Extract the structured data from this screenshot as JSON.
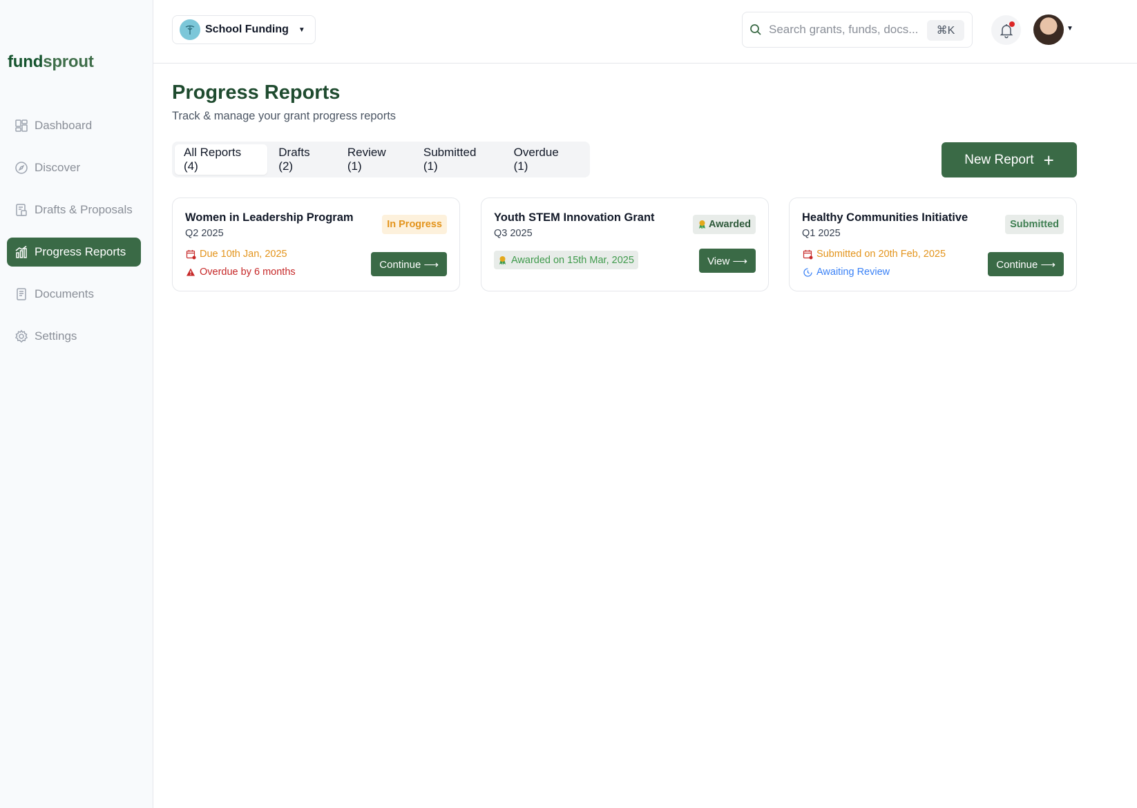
{
  "brand": {
    "part1": "fund",
    "part2": "sprout"
  },
  "sidebar": {
    "items": [
      {
        "label": "Dashboard",
        "icon": "dashboard-icon"
      },
      {
        "label": "Discover",
        "icon": "compass-icon"
      },
      {
        "label": "Drafts & Proposals",
        "icon": "drafts-icon"
      },
      {
        "label": "Progress Reports",
        "icon": "chart-icon",
        "active": true
      },
      {
        "label": "Documents",
        "icon": "documents-icon"
      },
      {
        "label": "Settings",
        "icon": "gear-icon"
      }
    ]
  },
  "header": {
    "org_name": "School Funding",
    "search_placeholder": "Search grants, funds, docs...",
    "search_shortcut": "⌘K"
  },
  "main": {
    "title": "Progress Reports",
    "subtitle": "Track & manage your grant progress reports",
    "tabs": [
      {
        "label": "All Reports (4)",
        "active": true
      },
      {
        "label": "Drafts (2)"
      },
      {
        "label": "Review (1)"
      },
      {
        "label": "Submitted (1)"
      },
      {
        "label": "Overdue (1)"
      }
    ],
    "new_report_label": "New Report",
    "cards": [
      {
        "title": "Women in Leadership Program",
        "quarter": "Q2 2025",
        "badge": "In Progress",
        "line1": "Due 10th Jan, 2025",
        "line2": "Overdue by 6 months",
        "button": "Continue ⟶"
      },
      {
        "title": "Youth STEM Innovation Grant",
        "quarter": "Q3 2025",
        "badge": "Awarded",
        "line1": "Awarded on 15th Mar, 2025",
        "button": "View ⟶"
      },
      {
        "title": "Healthy Communities Initiative",
        "quarter": "Q1 2025",
        "badge": "Submitted",
        "line1": "Submitted on 20th Feb, 2025",
        "line2": "Awaiting Review",
        "button": "Continue ⟶"
      }
    ]
  },
  "colors": {
    "accent": "#3a6a46",
    "brand_dark": "#1f4b2f",
    "warning": "#e3941c",
    "danger": "#c62828",
    "info": "#3b82f6"
  }
}
